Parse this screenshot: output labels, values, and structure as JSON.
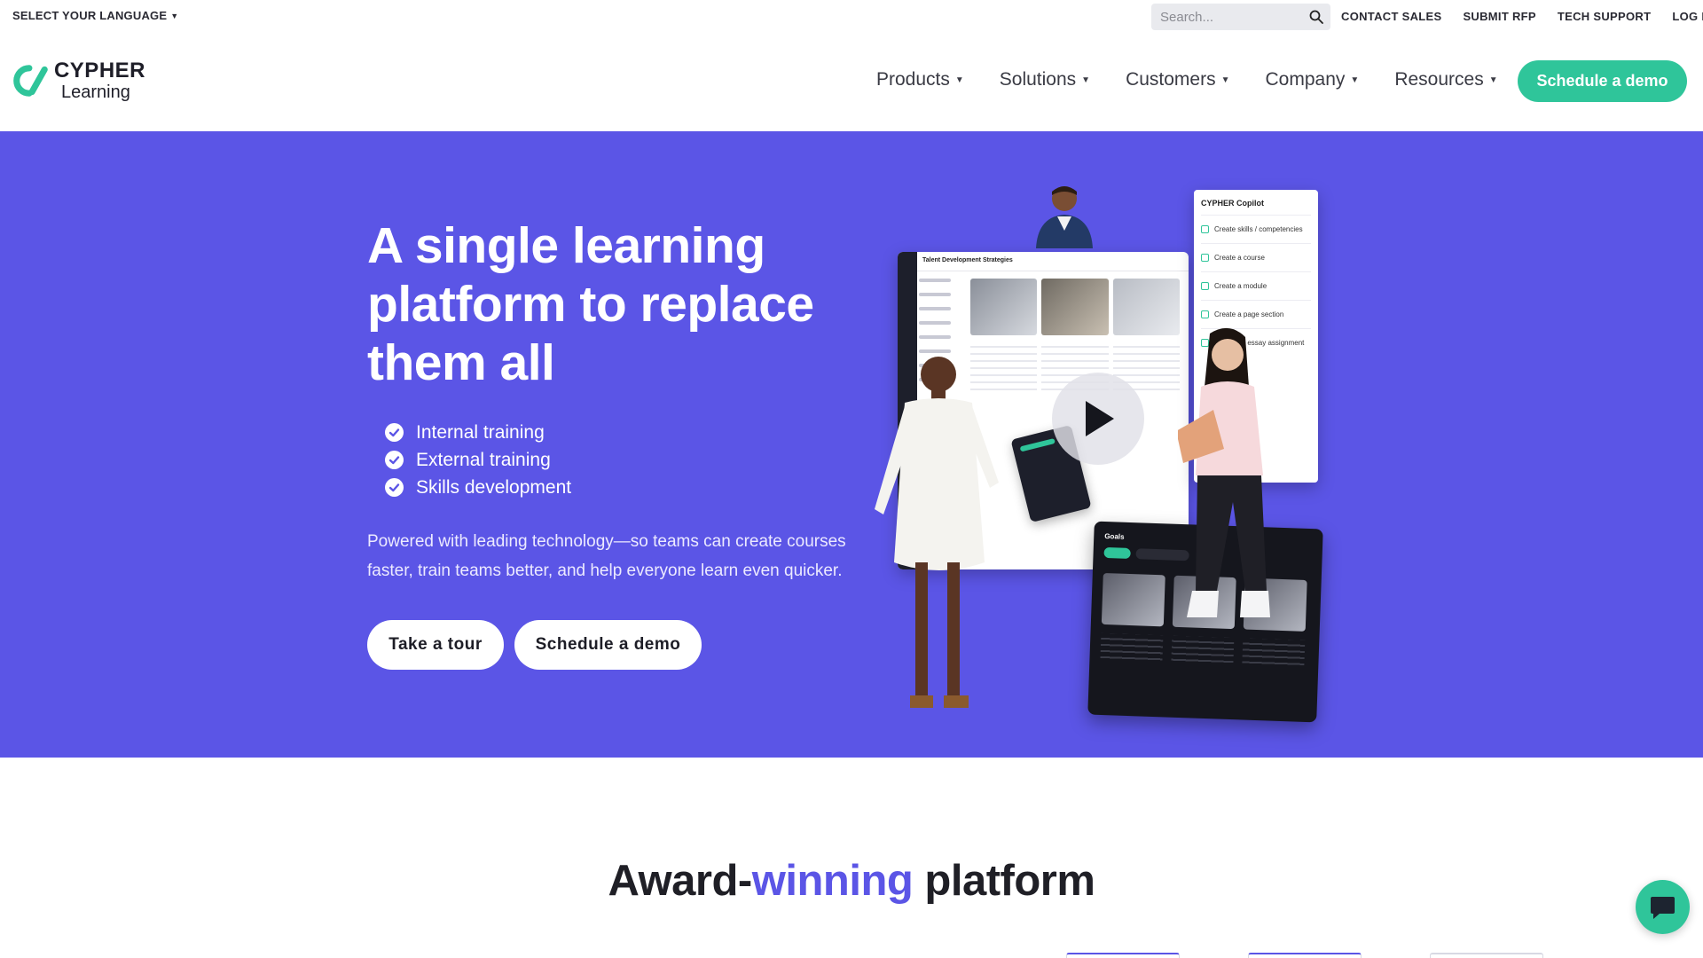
{
  "utility": {
    "language_label": "SELECT YOUR LANGUAGE",
    "search_placeholder": "Search...",
    "links": [
      "CONTACT SALES",
      "SUBMIT RFP",
      "TECH SUPPORT",
      "LOG IN"
    ]
  },
  "brand": {
    "name_line1": "CYPHER",
    "name_line2": "Learning",
    "accent_color": "#2fc59a",
    "hero_color": "#5b55e6"
  },
  "nav": {
    "items": [
      "Products",
      "Solutions",
      "Customers",
      "Company",
      "Resources"
    ],
    "cta": "Schedule a demo"
  },
  "hero": {
    "title": "A single learning platform to replace them all",
    "checklist": [
      "Internal training",
      "External training",
      "Skills development"
    ],
    "description": "Powered with leading technology—so teams can create courses faster, train teams better, and help everyone learn even quicker.",
    "buttons": {
      "tour": "Take a tour",
      "demo": "Schedule a demo"
    },
    "illustration": {
      "app_title": "Talent Development Strategies",
      "copilot_title": "CYPHER Copilot",
      "copilot_items": [
        "Create skills / competencies",
        "Create a course",
        "Create a module",
        "Create a page section",
        "Create an essay assignment"
      ],
      "goals_title": "Goals"
    }
  },
  "award": {
    "heading_start": "Award-",
    "heading_accent": "winning",
    "heading_end": " platform"
  },
  "icons": {
    "search": "search-icon",
    "check": "check-circle-icon",
    "play": "play-icon",
    "chat": "chat-icon"
  }
}
